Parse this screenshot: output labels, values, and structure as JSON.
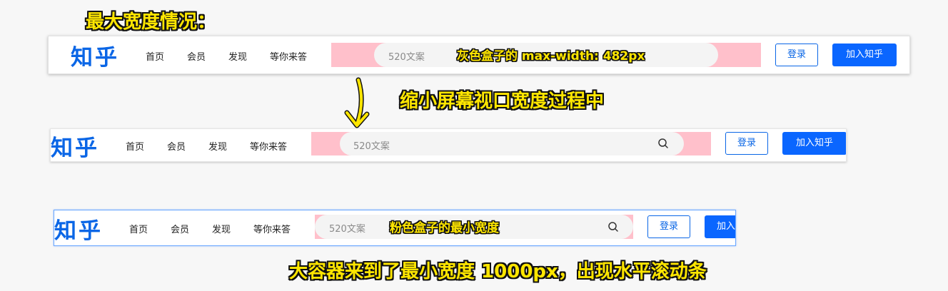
{
  "annotations": {
    "max_width_title": "最大宽度情况：",
    "shrinking": "缩小屏幕视口宽度过程中",
    "min_width_note": "大容器来到了最小宽度 1000px，出现水平滚动条",
    "gray_box_max": "灰色盒子的 max-width: 482px",
    "pink_box_min": "粉色盒子的最小宽度"
  },
  "header": {
    "logo": "知乎",
    "nav": [
      "首页",
      "会员",
      "发现",
      "等你来答"
    ],
    "search_placeholder": "520文案",
    "login_label": "登录",
    "join_label": "加入知乎",
    "join_label_cut": "加入"
  },
  "colors": {
    "brand_blue": "#0a66e6",
    "pink": "#ffc0cb",
    "annotation_yellow": "#ffe600",
    "search_gray": "#f4f4f4"
  },
  "icons": [
    "search-icon",
    "down-arrow-icon"
  ]
}
